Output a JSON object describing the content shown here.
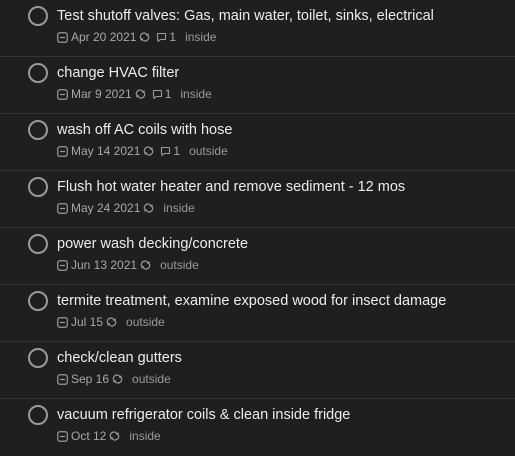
{
  "tasks": [
    {
      "title": "Test shutoff valves: Gas, main water, toilet, sinks, electrical",
      "date": "Apr 20 2021",
      "repeat": true,
      "comments": "1",
      "tag": "inside"
    },
    {
      "title": "change HVAC filter",
      "date": "Mar 9 2021",
      "repeat": true,
      "comments": "1",
      "tag": "inside"
    },
    {
      "title": "wash off AC coils with hose",
      "date": "May 14 2021",
      "repeat": true,
      "comments": "1",
      "tag": "outside"
    },
    {
      "title": "Flush hot water heater and remove sediment - 12 mos",
      "date": "May 24 2021",
      "repeat": true,
      "comments": null,
      "tag": "inside"
    },
    {
      "title": "power wash decking/concrete",
      "date": "Jun 13 2021",
      "repeat": true,
      "comments": null,
      "tag": "outside"
    },
    {
      "title": "termite treatment, examine exposed wood for insect damage",
      "date": "Jul 15",
      "repeat": true,
      "comments": null,
      "tag": "outside"
    },
    {
      "title": "check/clean gutters",
      "date": "Sep 16",
      "repeat": true,
      "comments": null,
      "tag": "outside"
    },
    {
      "title": "vacuum refrigerator coils & clean inside fridge",
      "date": "Oct 12",
      "repeat": true,
      "comments": null,
      "tag": "inside"
    }
  ],
  "colors": {
    "background": "#1f1f1f",
    "divider": "#343434",
    "text": "#ececec",
    "meta": "#9a9a9a"
  },
  "icons": {
    "checkbox": "circle-checkbox-icon",
    "date": "calendar-icon",
    "repeat": "repeat-icon",
    "comment": "comment-icon"
  }
}
